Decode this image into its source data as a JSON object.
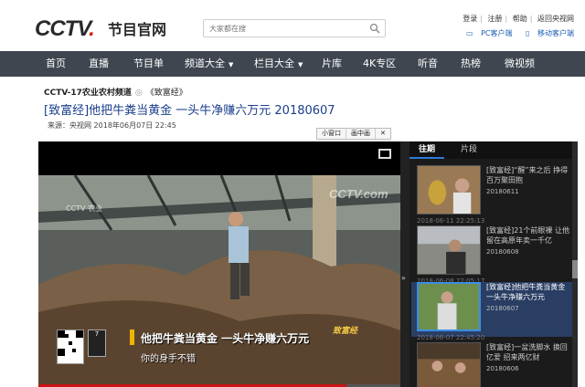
{
  "header": {
    "logo": "CCTV",
    "logo_dot": ".",
    "logo_sub": "节目官网",
    "search_placeholder": "大家都在搜",
    "top_links": [
      "登录",
      "注册",
      "帮助",
      "返回央视网"
    ],
    "sub_links": [
      "PC客户端",
      "移动客户端"
    ]
  },
  "nav": {
    "items": [
      "首页",
      "直播",
      "节目单",
      "频道大全",
      "栏目大全",
      "片库",
      "4K专区",
      "听音",
      "热榜",
      "微视频"
    ]
  },
  "breadcrumb": {
    "channel": "CCTV-17农业农村频道",
    "program": "《致富经》"
  },
  "video": {
    "title": "[致富经]他把牛粪当黄金 一头牛净赚六万元 20180607",
    "meta_source": "来源：央视网",
    "meta_date": "2018年06月07日 22:45",
    "mini_buttons": [
      "小窗口",
      "画中画"
    ],
    "watermark": "CCTV.com",
    "watermark_small": "CCTV 农业",
    "caption": "他把牛粪当黄金 一头牛净赚六万元",
    "subtitle": "你的身手不错",
    "badge": "7",
    "show_logo": "致富经",
    "progress": 0.85
  },
  "sidebar": {
    "tabs": [
      "往期",
      "片段"
    ],
    "items": [
      {
        "title": "[致富经]“醒”来之后 挣得百万聚田抱",
        "date": "20180611",
        "time": "2018-06-11 22:25:13",
        "active": false
      },
      {
        "title": "[致富经]21个前眼裸 让他留在高原年卖一千亿",
        "date": "20180608",
        "time": "2018-06-08 22:05:17",
        "active": false
      },
      {
        "title": "[致富经]他把牛粪当黄金 一头牛净赚六万元",
        "date": "20180607",
        "time": "2018-06-07 22:45:20",
        "active": true
      },
      {
        "title": "[致富经]一盆洗脚水 换回亿爱 招来两亿财",
        "date": "20180606",
        "time": "",
        "active": false
      }
    ]
  },
  "colors": {
    "nav_bg": "#3f4650",
    "title_blue": "#1a3e8c",
    "accent_red": "#d81e06",
    "active_item": "#2a3e64"
  }
}
